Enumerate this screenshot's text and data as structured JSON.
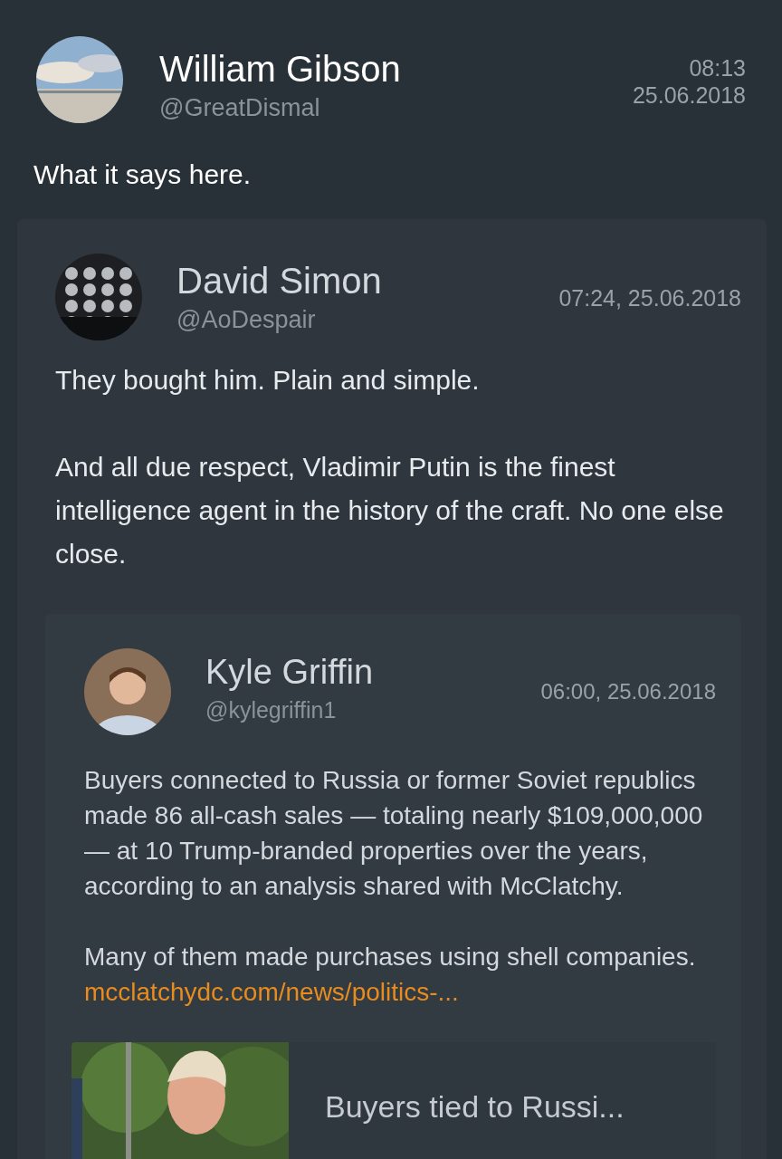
{
  "tweet": {
    "author": {
      "name": "William Gibson",
      "handle": "@GreatDismal"
    },
    "time": "08:13",
    "date": "25.06.2018",
    "text": "What it says here.",
    "quoted": {
      "author": {
        "name": "David Simon",
        "handle": "@AoDespair"
      },
      "timestamp": "07:24, 25.06.2018",
      "paragraphs": [
        {
          "text": "They bought him. Plain and simple."
        },
        {
          "text": "And all due respect, Vladimir Putin is the finest intelligence agent in the history of the craft. No one else close."
        }
      ],
      "quoted": {
        "author": {
          "name": "Kyle Griffin",
          "handle": "@kylegriffin1"
        },
        "timestamp": "06:00, 25.06.2018",
        "paragraphs": [
          {
            "text": "Buyers connected to Russia or former Soviet republics made 86 all-cash sales — totaling nearly $109,000,000 — at 10 Trump-branded properties over the years, according to an analysis shared with McClatchy."
          },
          {
            "text": "Many of them made purchases using shell companies.",
            "link": "mcclatchydc.com/news/politics-..."
          }
        ],
        "link_card": {
          "title": "Buyers tied to Russi..."
        }
      }
    }
  }
}
